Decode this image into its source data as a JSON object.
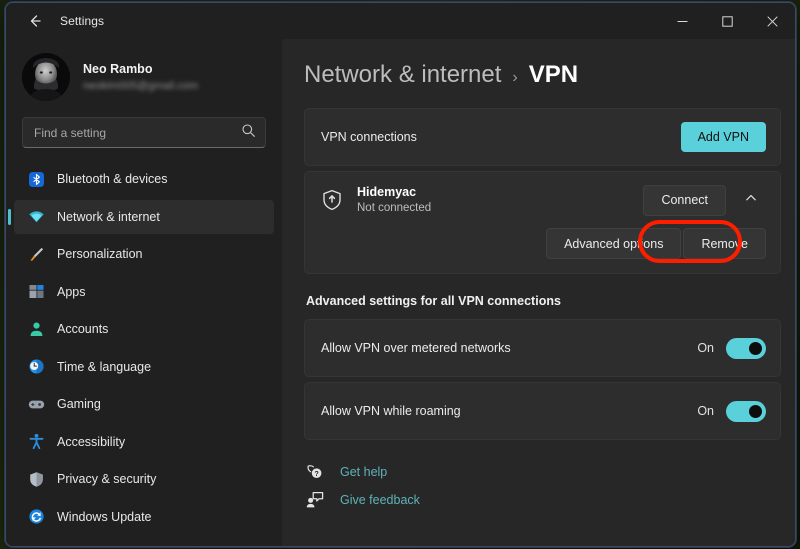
{
  "window": {
    "title": "Settings",
    "back_icon": "back-arrow-icon",
    "minimize_label": "—",
    "maximize_label": "□",
    "close_label": "✕"
  },
  "account": {
    "name": "Neo Rambo",
    "email": "neokim005@gmail.com",
    "avatar_name": "user-avatar"
  },
  "search": {
    "placeholder": "Find a setting",
    "value": "",
    "icon": "search-icon"
  },
  "sidebar": {
    "items": [
      {
        "label": "Bluetooth & devices",
        "icon": "bluetooth-icon",
        "selected": false
      },
      {
        "label": "Network & internet",
        "icon": "wifi-icon",
        "selected": true
      },
      {
        "label": "Personalization",
        "icon": "paintbrush-icon",
        "selected": false
      },
      {
        "label": "Apps",
        "icon": "apps-icon",
        "selected": false
      },
      {
        "label": "Accounts",
        "icon": "person-icon",
        "selected": false
      },
      {
        "label": "Time & language",
        "icon": "clock-icon",
        "selected": false
      },
      {
        "label": "Gaming",
        "icon": "gamepad-icon",
        "selected": false
      },
      {
        "label": "Accessibility",
        "icon": "accessibility-icon",
        "selected": false
      },
      {
        "label": "Privacy & security",
        "icon": "shield-icon",
        "selected": false
      },
      {
        "label": "Windows Update",
        "icon": "update-icon",
        "selected": false
      }
    ]
  },
  "breadcrumb": {
    "parent": "Network & internet",
    "separator": "›",
    "current": "VPN"
  },
  "vpn_connections_card": {
    "label": "VPN connections",
    "add_button": "Add VPN"
  },
  "vpn_entry": {
    "icon": "vpn-shield-icon",
    "name": "Hidemyac",
    "status": "Not connected",
    "connect_button": "Connect",
    "expand_icon": "chevron-up-icon",
    "advanced_options_button": "Advanced options",
    "remove_button": "Remove",
    "highlight_color": "#ff1d00"
  },
  "advanced_settings": {
    "heading": "Advanced settings for all VPN connections",
    "rows": [
      {
        "label": "Allow VPN over metered networks",
        "state": "On"
      },
      {
        "label": "Allow VPN while roaming",
        "state": "On"
      }
    ]
  },
  "footer": {
    "links": [
      {
        "label": "Get help",
        "icon": "help-icon"
      },
      {
        "label": "Give feedback",
        "icon": "feedback-icon"
      }
    ]
  },
  "colors": {
    "accent": "#5ad1da",
    "link": "#5fb3b8",
    "highlight": "#ff1d00"
  }
}
